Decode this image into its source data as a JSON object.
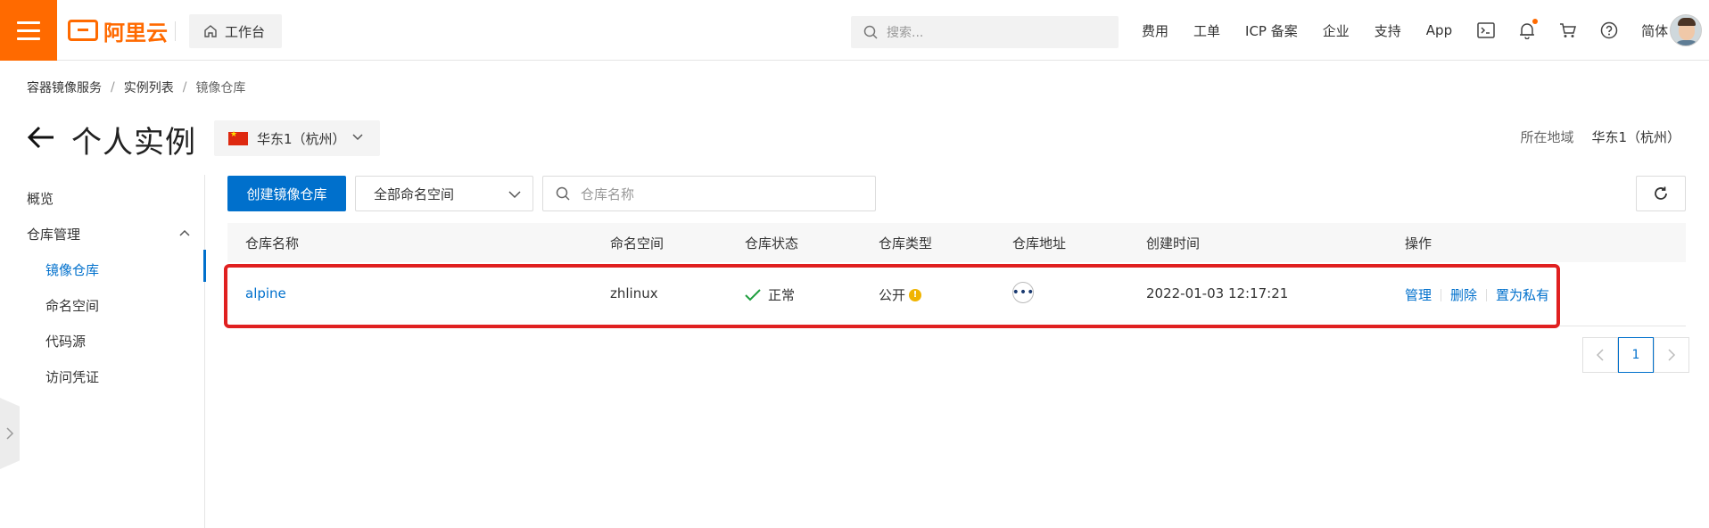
{
  "topbar": {
    "brand": "阿里云",
    "workbench": "工作台",
    "search_placeholder": "搜索...",
    "nav_links": [
      "费用",
      "工单",
      "ICP 备案",
      "企业",
      "支持",
      "App"
    ],
    "language": "简体",
    "accent_color": "#ff6a00",
    "icons": [
      "terminal-icon",
      "bell-icon",
      "cart-icon",
      "help-icon"
    ]
  },
  "breadcrumb": [
    "容器镜像服务",
    "实例列表",
    "镜像仓库"
  ],
  "header": {
    "title": "个人实例",
    "region_selected": "华东1（杭州）",
    "region_label": "所在地域",
    "region_value": "华东1（杭州）"
  },
  "sidebar": {
    "overview": "概览",
    "group": "仓库管理",
    "items": [
      "镜像仓库",
      "命名空间",
      "代码源",
      "访问凭证"
    ],
    "active": "镜像仓库"
  },
  "toolbar": {
    "create_label": "创建镜像仓库",
    "namespace_filter": "全部命名空间",
    "search_placeholder": "仓库名称"
  },
  "table": {
    "columns": [
      "仓库名称",
      "命名空间",
      "仓库状态",
      "仓库类型",
      "仓库地址",
      "创建时间",
      "操作"
    ],
    "rows": [
      {
        "name": "alpine",
        "namespace": "zhlinux",
        "status": "正常",
        "type": "公开",
        "created": "2022-01-03 12:17:21",
        "actions": [
          "管理",
          "删除",
          "置为私有"
        ]
      }
    ]
  },
  "pagination": {
    "current": "1"
  },
  "colors": {
    "primary": "#0070cc",
    "success": "#1e9e3e",
    "highlight_border": "#e02020"
  }
}
